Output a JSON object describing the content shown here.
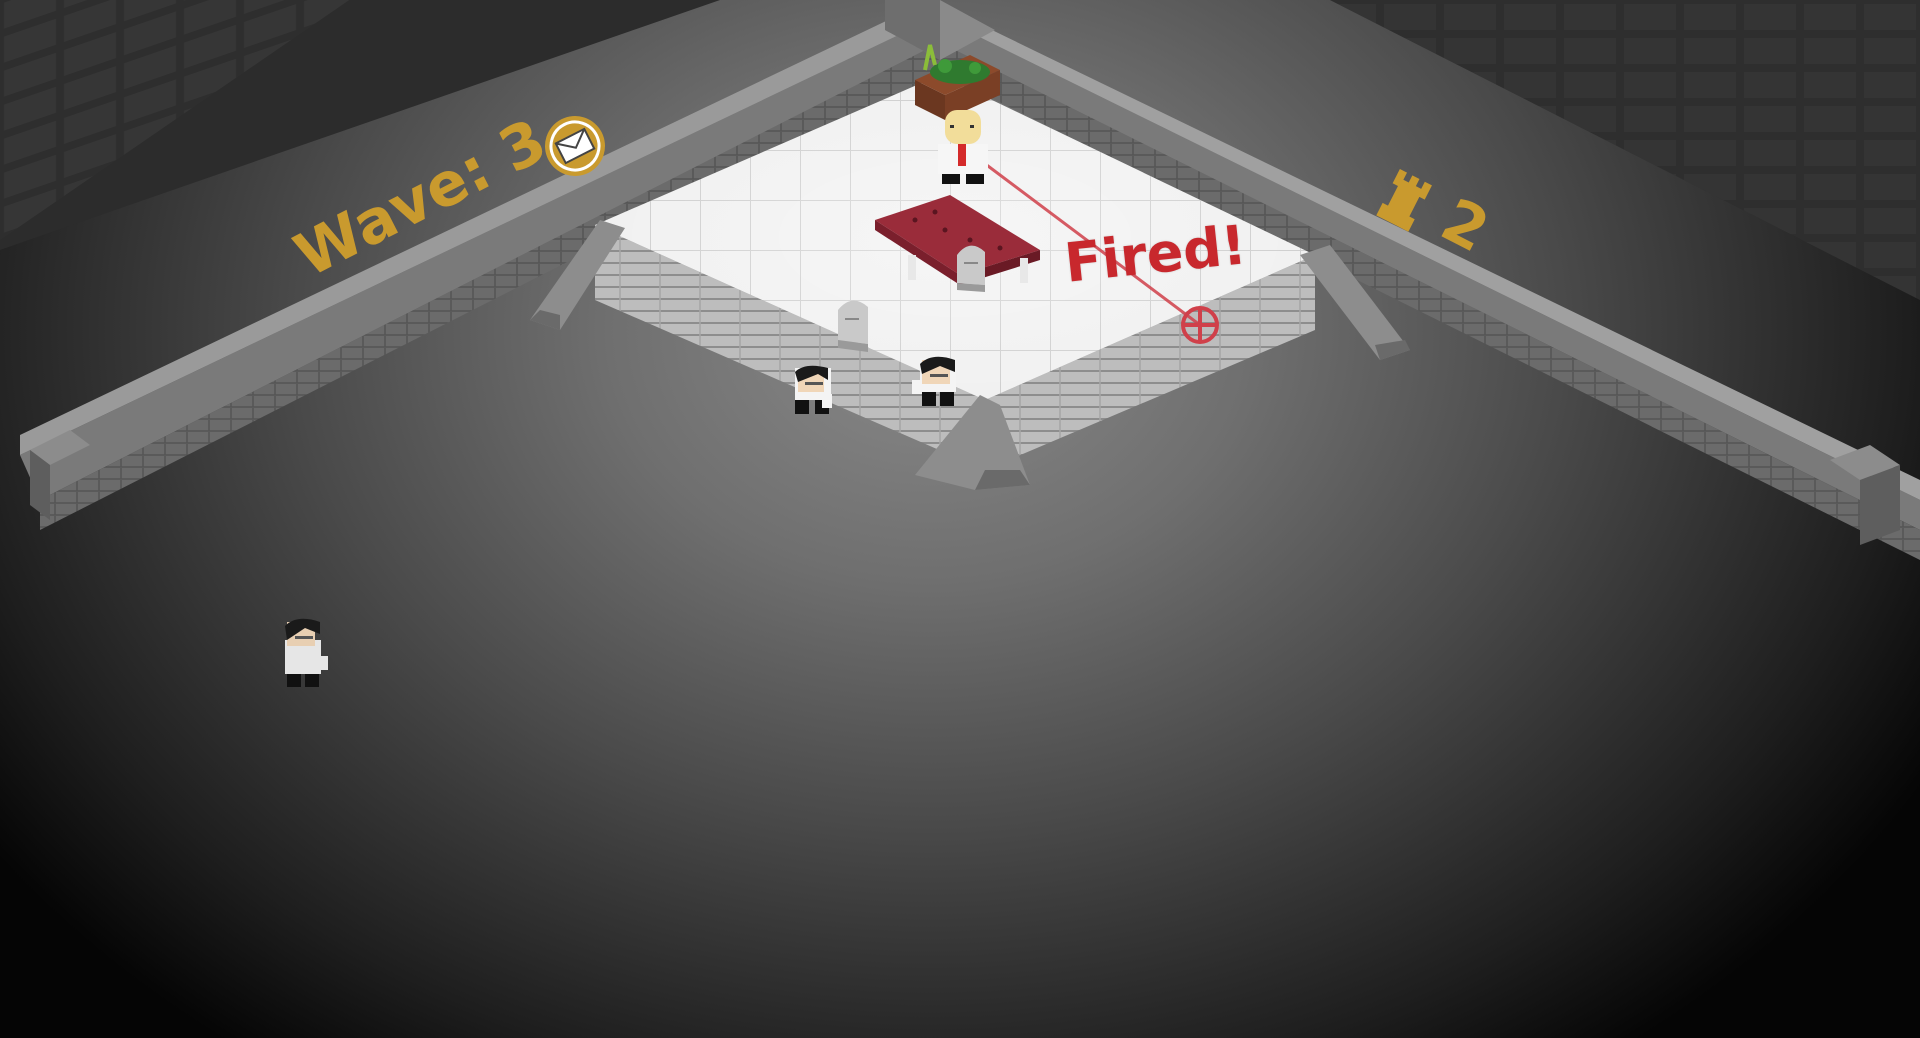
{
  "hud": {
    "wave_label": "Wave:",
    "wave_value": "3",
    "rook_count": "2",
    "fired_text": "Fired!"
  },
  "icons": {
    "mail": "envelope-coin-icon",
    "rook": "rook-icon",
    "target": "crosshair-target-icon"
  },
  "colors": {
    "accent": "#c99a2e",
    "fired": "#c8282d",
    "carpet": "#9a2c3a"
  }
}
